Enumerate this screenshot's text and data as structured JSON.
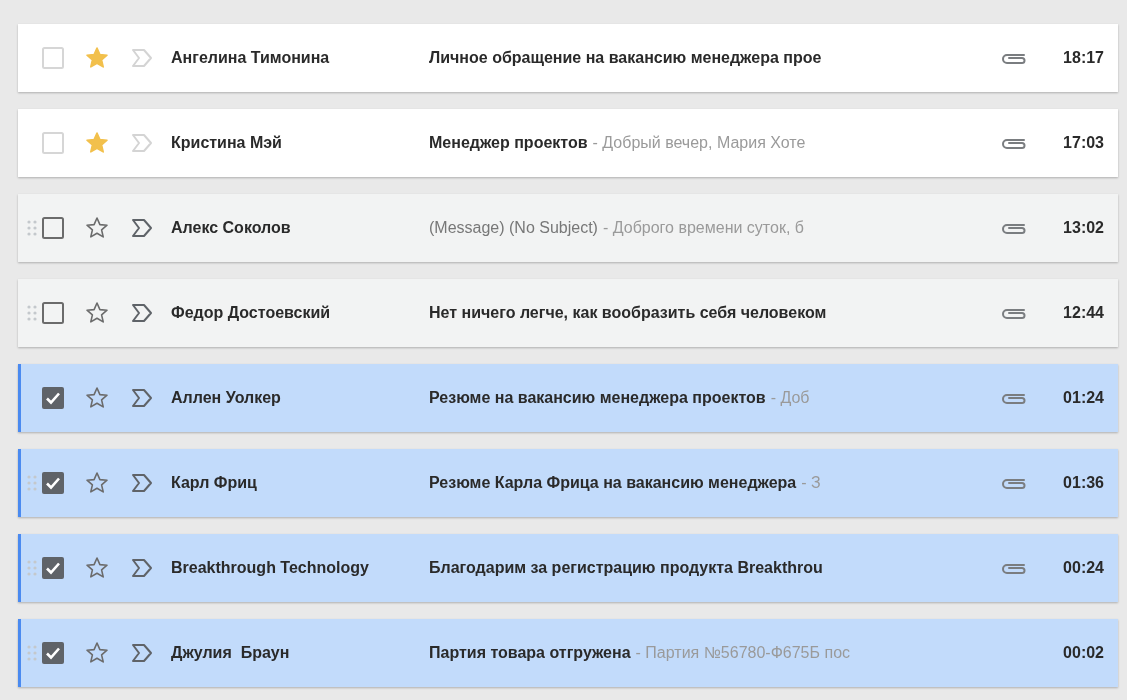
{
  "messages": [
    {
      "sender": "Ангелина Тимонина",
      "subject": "Личное обращение на вакансию менеджера прое",
      "subject_bold": true,
      "attachment": true,
      "time": "18:17",
      "checked": false,
      "starred": true,
      "faded": true,
      "drag_handle": false
    },
    {
      "sender": "Кристина Мэй",
      "subject": "Менеджер проектов",
      "snippet": "- Добрый вечер, Мария Хоте",
      "subject_bold": true,
      "attachment": true,
      "time": "17:03",
      "checked": false,
      "starred": true,
      "faded": true,
      "drag_handle": false
    },
    {
      "sender": "Алекс Соколов",
      "subject": "(Message) (No Subject)",
      "snippet": "- Доброго времени суток, б",
      "subject_bold": false,
      "attachment": true,
      "time": "13:02",
      "checked": false,
      "starred": false,
      "faded": false,
      "drag_handle": true
    },
    {
      "sender": "Федор Достоевский",
      "subject": "Нет ничего легче, как вообразить себя человеком",
      "subject_bold": true,
      "attachment": true,
      "time": "12:44",
      "checked": false,
      "starred": false,
      "faded": false,
      "drag_handle": true
    },
    {
      "sender": "Аллен Уолкер",
      "subject": "Резюме на вакансию менеджера проектов",
      "snippet": "- Доб",
      "subject_bold": true,
      "attachment": true,
      "time": "01:24",
      "checked": true,
      "starred": false,
      "faded": false,
      "drag_handle": false
    },
    {
      "sender": "Карл Фриц",
      "subject": "Резюме Карла Фрица на вакансию менеджера",
      "snippet": "- З",
      "subject_bold": true,
      "attachment": true,
      "time": "01:36",
      "checked": true,
      "starred": false,
      "faded": false,
      "drag_handle": true
    },
    {
      "sender": "Breakthrough Technology",
      "subject": "Благодарим за регистрацию продукта Breakthrou",
      "subject_bold": true,
      "attachment": true,
      "time": "00:24",
      "checked": true,
      "starred": false,
      "faded": false,
      "drag_handle": true
    },
    {
      "sender": "Джулия  Браун",
      "subject": "Партия товара отгружена",
      "snippet": "- Партия №56780-Ф675Б пос",
      "subject_bold": true,
      "attachment": false,
      "time": "00:02",
      "checked": true,
      "starred": false,
      "faded": false,
      "drag_handle": true
    }
  ]
}
